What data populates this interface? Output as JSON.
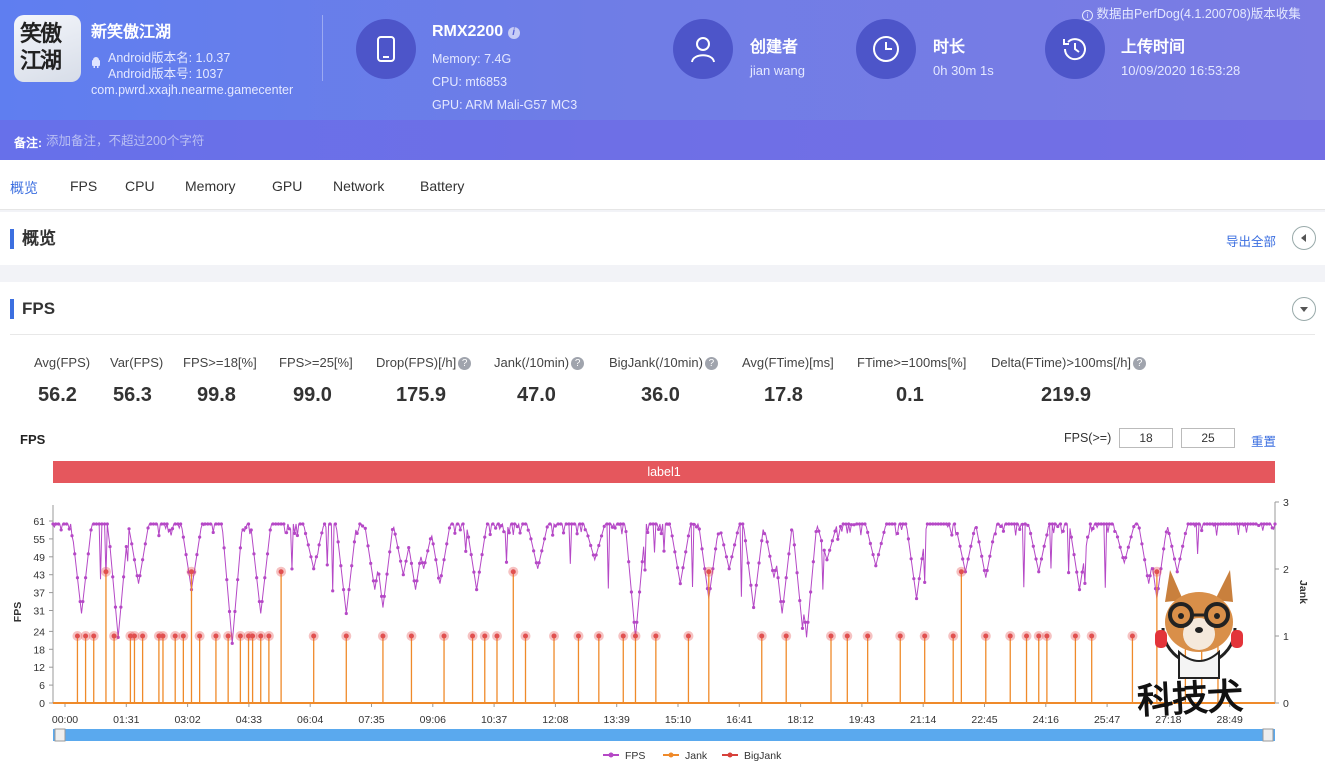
{
  "app": {
    "name": "新笑傲江湖",
    "icon_text": "笑傲江湖",
    "version_name": "Android版本名: 1.0.37",
    "version_code": "Android版本号: 1037",
    "package": "com.pwrd.xxajh.nearme.gamecenter"
  },
  "device": {
    "model": "RMX2200",
    "memory": "Memory: 7.4G",
    "cpu": "CPU: mt6853",
    "gpu": "GPU: ARM Mali-G57 MC3"
  },
  "creator": {
    "label": "创建者",
    "value": "jian wang"
  },
  "duration": {
    "label": "时长",
    "value": "0h 30m 1s"
  },
  "upload": {
    "label": "上传时间",
    "value": "10/09/2020 16:53:28"
  },
  "source_note": "数据由PerfDog(4.1.200708)版本收集",
  "note": {
    "label": "备注:",
    "placeholder": "添加备注，不超过200个字符"
  },
  "tabs": [
    "概览",
    "FPS",
    "CPU",
    "Memory",
    "GPU",
    "Network",
    "Battery"
  ],
  "overview": {
    "title": "概览",
    "export": "导出全部"
  },
  "fps_section": {
    "title": "FPS",
    "stats": [
      {
        "label": "Avg(FPS)",
        "value": "56.2",
        "help": false
      },
      {
        "label": "Var(FPS)",
        "value": "56.3",
        "help": false
      },
      {
        "label": "FPS>=18[%]",
        "value": "99.8",
        "help": false
      },
      {
        "label": "FPS>=25[%]",
        "value": "99.0",
        "help": false
      },
      {
        "label": "Drop(FPS)[/h]",
        "value": "175.9",
        "help": true
      },
      {
        "label": "Jank(/10min)",
        "value": "47.0",
        "help": true
      },
      {
        "label": "BigJank(/10min)",
        "value": "36.0",
        "help": true
      },
      {
        "label": "Avg(FTime)[ms]",
        "value": "17.8",
        "help": false
      },
      {
        "label": "FTime>=100ms[%]",
        "value": "0.1",
        "help": false
      },
      {
        "label": "Delta(FTime)>100ms[/h]",
        "value": "219.9",
        "help": true
      }
    ],
    "chart_title": "FPS",
    "threshold_label": "FPS(>=)",
    "threshold1": "18",
    "threshold2": "25",
    "reset": "重置",
    "label_bar": "label1"
  },
  "watermark_text": "科技犬",
  "colors": {
    "accent": "#3c6fe0",
    "fps": "#b548c6",
    "jank": "#ef8a2a",
    "bigjank": "#d7413a",
    "label_bar": "#e5575d"
  },
  "chart_data": {
    "type": "line",
    "title": "FPS",
    "x_tick_labels": [
      "00:00",
      "01:31",
      "03:02",
      "04:33",
      "06:04",
      "07:35",
      "09:06",
      "10:37",
      "12:08",
      "13:39",
      "15:10",
      "16:41",
      "18:12",
      "19:43",
      "21:14",
      "22:45",
      "24:16",
      "25:47",
      "27:18",
      "28:49"
    ],
    "xlabel": "",
    "ylabel": "FPS",
    "y_ticks": [
      0,
      6,
      12,
      18,
      24,
      31,
      37,
      43,
      49,
      55,
      61
    ],
    "ylim": [
      0,
      61
    ],
    "y2label": "Jank",
    "y2_ticks": [
      0,
      1,
      2,
      3
    ],
    "y2lim": [
      0,
      3
    ],
    "x_range_min": [
      0,
      30
    ],
    "series": [
      {
        "name": "FPS",
        "axis": "left",
        "typical": 60,
        "min": 10,
        "dips_min": [
          [
            0.7,
            30
          ],
          [
            1.6,
            22
          ],
          [
            2.1,
            40
          ],
          [
            3.4,
            38
          ],
          [
            4.4,
            20
          ],
          [
            5.1,
            30
          ],
          [
            6.4,
            45
          ],
          [
            7.2,
            30
          ],
          [
            7.9,
            38
          ],
          [
            8.1,
            32
          ],
          [
            8.6,
            43
          ],
          [
            8.9,
            38
          ],
          [
            9.1,
            45
          ],
          [
            9.5,
            40
          ],
          [
            10.4,
            38
          ],
          [
            11.9,
            45
          ],
          [
            13.3,
            48
          ],
          [
            14.3,
            22
          ],
          [
            15.4,
            40
          ],
          [
            16.1,
            35
          ],
          [
            16.6,
            45
          ],
          [
            17.2,
            32
          ],
          [
            17.7,
            42
          ],
          [
            17.9,
            30
          ],
          [
            18.4,
            25
          ],
          [
            18.5,
            22
          ],
          [
            19.0,
            48
          ],
          [
            20.2,
            46
          ],
          [
            21.2,
            35
          ],
          [
            22.4,
            44
          ],
          [
            22.9,
            42
          ],
          [
            24.2,
            44
          ],
          [
            25.2,
            38
          ],
          [
            26.3,
            47
          ],
          [
            26.9,
            40
          ],
          [
            27.1,
            35
          ],
          [
            27.6,
            44
          ]
        ]
      },
      {
        "name": "Jank",
        "axis": "right",
        "events_min": [
          0.6,
          0.8,
          1.0,
          1.3,
          1.5,
          1.9,
          2.0,
          2.2,
          2.6,
          2.7,
          3.0,
          3.2,
          3.4,
          3.6,
          4.0,
          4.3,
          4.6,
          4.8,
          4.9,
          5.1,
          5.3,
          5.6,
          6.4,
          7.2,
          8.1,
          8.8,
          9.6,
          10.3,
          10.6,
          10.9,
          11.3,
          11.6,
          12.3,
          12.9,
          13.4,
          14.0,
          14.3,
          14.8,
          15.6,
          16.1,
          17.4,
          18.0,
          19.1,
          19.5,
          20.0,
          20.8,
          21.4,
          22.1,
          22.3,
          22.9,
          23.5,
          23.9,
          24.2,
          24.4,
          25.1,
          25.5,
          26.5,
          27.1,
          27.8,
          28.2,
          28.6
        ]
      },
      {
        "name": "BigJank",
        "axis": "right",
        "events_min": []
      }
    ],
    "legend": "bottom-center",
    "grid": false
  }
}
